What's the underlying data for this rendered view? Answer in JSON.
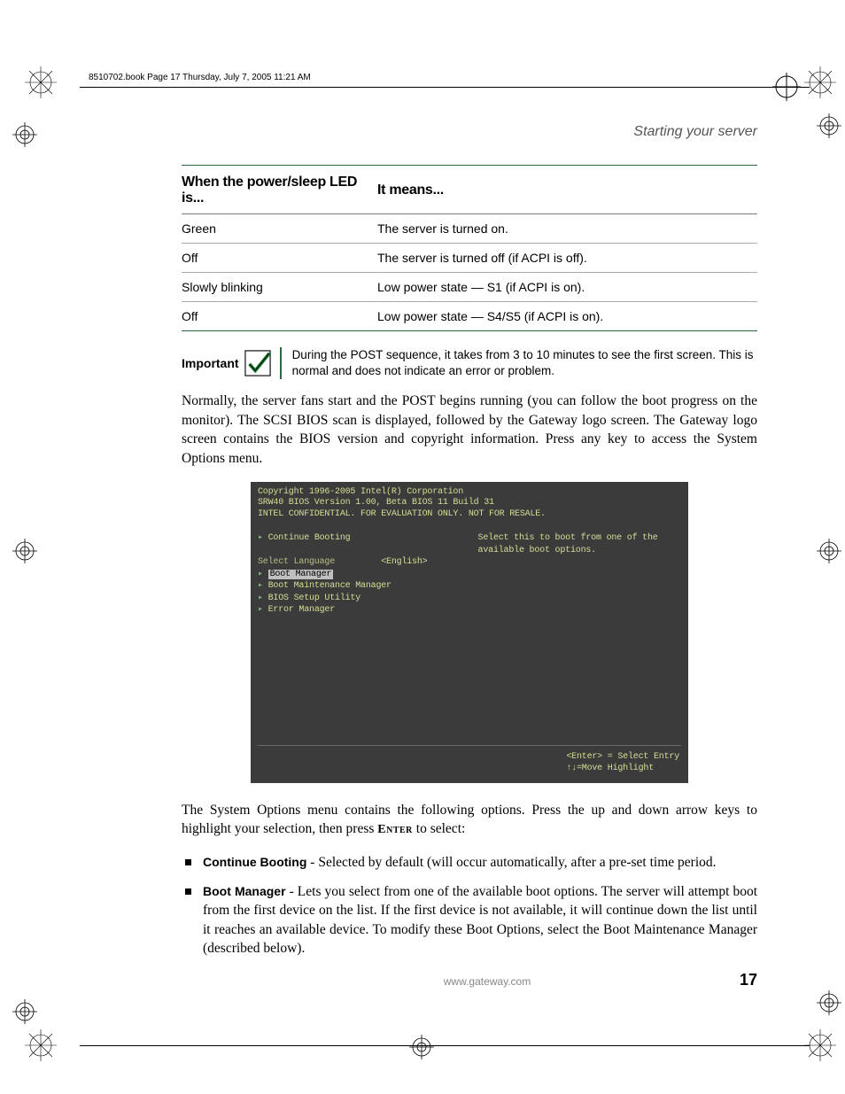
{
  "header": {
    "running_header": "8510702.book  Page 17  Thursday, July 7, 2005  11:21 AM"
  },
  "section_title": "Starting your server",
  "table": {
    "header_led": "When the power/sleep LED is...",
    "header_means": "It means...",
    "rows": [
      {
        "led": "Green",
        "means": "The server is turned on."
      },
      {
        "led": "Off",
        "means": "The server is turned off (if ACPI is off)."
      },
      {
        "led": "Slowly blinking",
        "means": "Low power state — S1 (if ACPI is on)."
      },
      {
        "led": "Off",
        "means": "Low power state — S4/S5 (if ACPI is on)."
      }
    ]
  },
  "important": {
    "label": "Important",
    "text": "During the POST sequence, it takes from 3 to 10 minutes to see the first screen. This is normal and does not indicate an error or problem."
  },
  "para1": "Normally, the server fans start and the POST begins running (you can follow the boot progress on the monitor). The SCSI BIOS scan is displayed, followed by the Gateway logo screen. The Gateway logo screen contains the BIOS version and copyright information. Press any key to access the System Options menu.",
  "bios": {
    "line1": "Copyright 1996-2005 Intel(R) Corporation",
    "line2": "SRW40 BIOS Version 1.00, Beta BIOS 11  Build 31",
    "line3": "INTEL CONFIDENTIAL. FOR EVALUATION ONLY. NOT FOR RESALE.",
    "menu": {
      "m1": "Continue Booting",
      "m2": "Select Language",
      "m2v": "<English>",
      "m3": "Boot Manager",
      "m4": "Boot Maintenance Manager",
      "m5": "BIOS Setup Utility",
      "m6": "Error Manager"
    },
    "side": "Select this to boot from one of the available boot options.",
    "help1": "<Enter> = Select Entry",
    "help2": "↑↓=Move Highlight"
  },
  "para2a": "The System Options menu contains the following options. Press the up and down arrow keys to highlight your selection, then press ",
  "para2b": "Enter",
  "para2c": " to select:",
  "options": [
    {
      "name": "Continue Booting",
      "desc": " - Selected by default (will occur automatically, after a pre-set time period."
    },
    {
      "name": "Boot Manager",
      "desc": " - Lets you select from one of the available boot options. The server will attempt boot from the first device on the list. If the first device is not available, it will continue down the list until it reaches an available device. To modify these Boot Options, select the Boot Maintenance Manager (described below)."
    }
  ],
  "footer": {
    "url": "www.gateway.com",
    "page": "17"
  }
}
